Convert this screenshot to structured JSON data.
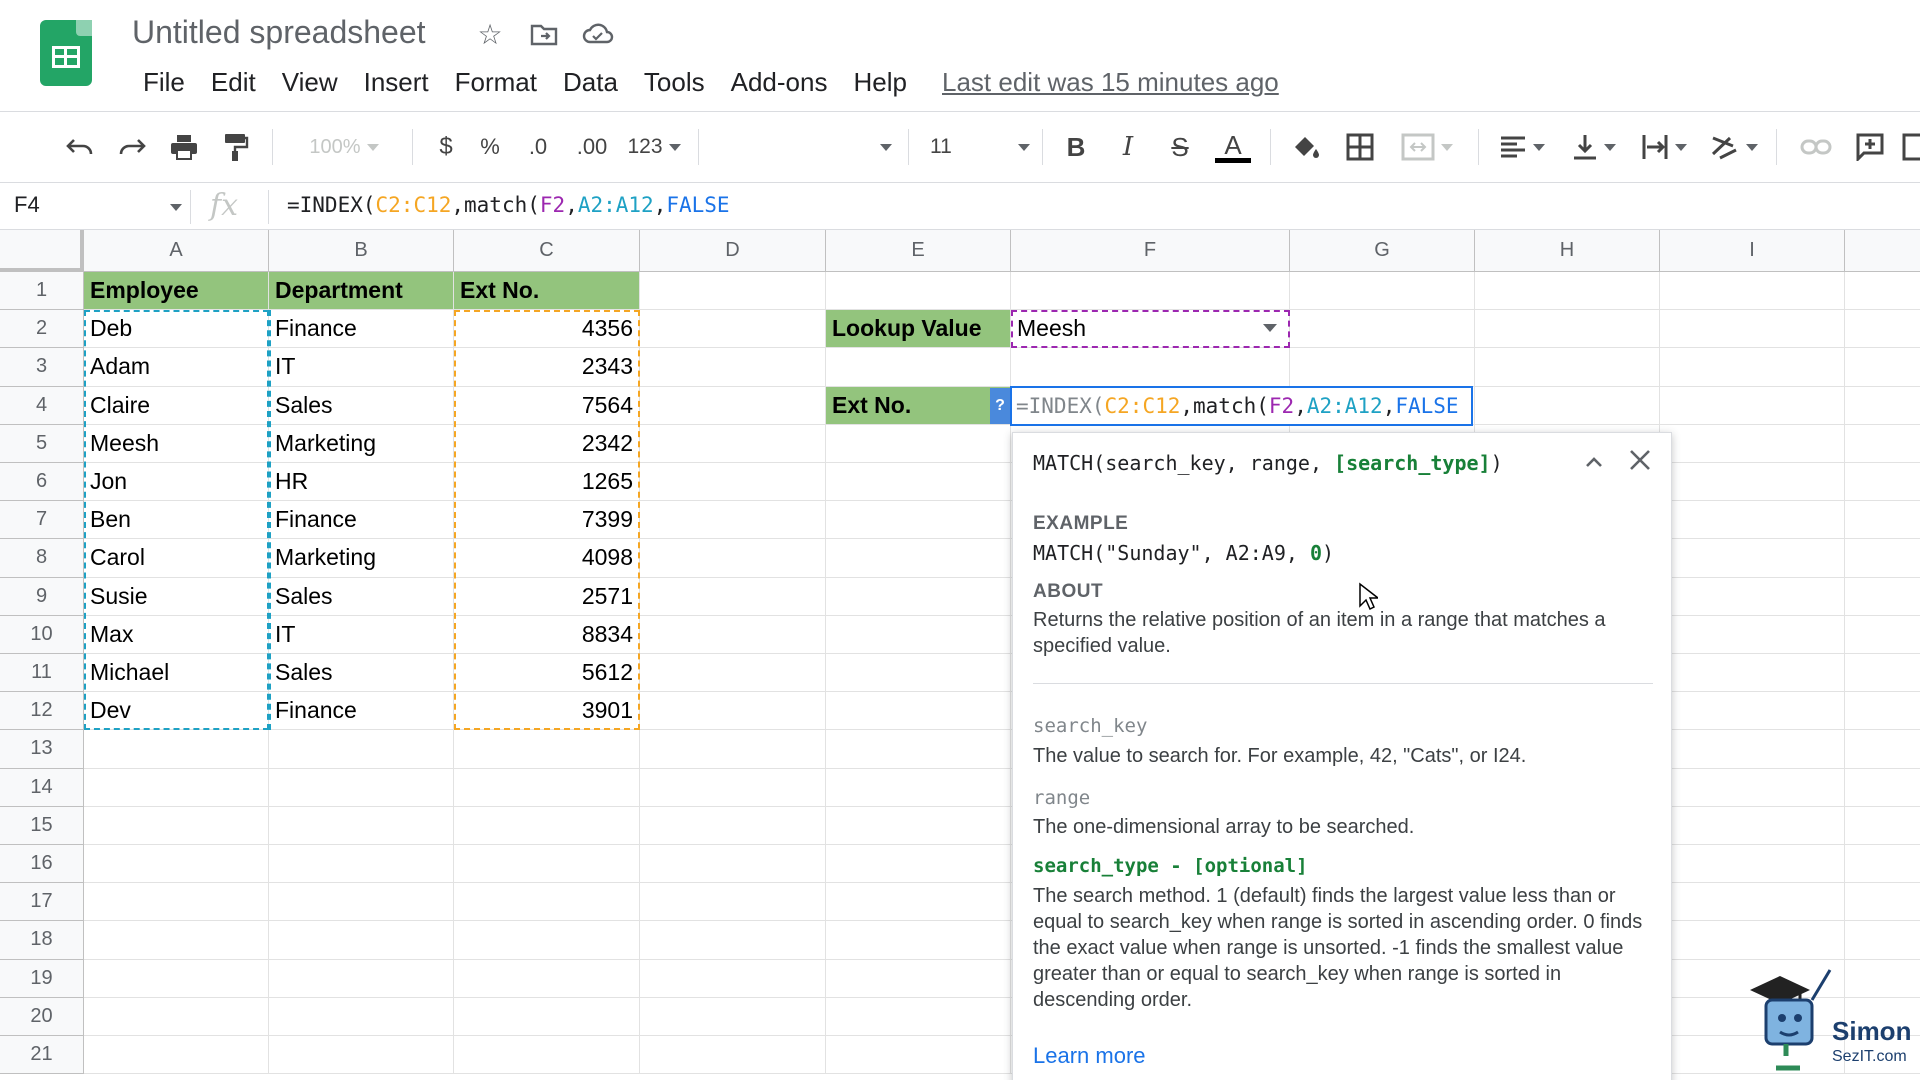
{
  "app": {
    "title": "Untitled spreadsheet",
    "menu": [
      "File",
      "Edit",
      "View",
      "Insert",
      "Format",
      "Data",
      "Tools",
      "Add-ons",
      "Help"
    ],
    "last_edit": "Last edit was 15 minutes ago"
  },
  "toolbar": {
    "zoom": "100%",
    "currency": "$",
    "percent": "%",
    "dec_decrease": ".0",
    "dec_increase": ".00",
    "more_formats": "123",
    "font_size": "11",
    "bold": "B",
    "italic": "I",
    "strike": "S",
    "text_color": "A"
  },
  "formula_bar": {
    "cell_ref": "F4",
    "fx": "fx",
    "formula_parts": [
      {
        "text": "=INDEX(",
        "color": "dark"
      },
      {
        "text": "C2:C12",
        "color": "orange"
      },
      {
        "text": ",match(",
        "color": "dark"
      },
      {
        "text": "F2",
        "color": "purple"
      },
      {
        "text": ",",
        "color": "dark"
      },
      {
        "text": "A2:A12",
        "color": "cyan"
      },
      {
        "text": ",",
        "color": "dark"
      },
      {
        "text": "FALSE",
        "color": "blue"
      }
    ]
  },
  "grid": {
    "columns": [
      "A",
      "B",
      "C",
      "D",
      "E",
      "F",
      "G",
      "H",
      "I"
    ],
    "rows": [
      "1",
      "2",
      "3",
      "4",
      "5",
      "6",
      "7",
      "8",
      "9",
      "10",
      "11",
      "12",
      "13",
      "14",
      "15",
      "16",
      "17",
      "18",
      "19",
      "20",
      "21"
    ],
    "table_headers": [
      "Employee",
      "Department",
      "Ext No."
    ],
    "table_rows": [
      [
        "Deb",
        "Finance",
        "4356"
      ],
      [
        "Adam",
        "IT",
        "2343"
      ],
      [
        "Claire",
        "Sales",
        "7564"
      ],
      [
        "Meesh",
        "Marketing",
        "2342"
      ],
      [
        "Jon",
        "HR",
        "1265"
      ],
      [
        "Ben",
        "Finance",
        "7399"
      ],
      [
        "Carol",
        "Marketing",
        "4098"
      ],
      [
        "Susie",
        "Sales",
        "2571"
      ],
      [
        "Max",
        "IT",
        "8834"
      ],
      [
        "Michael",
        "Sales",
        "5612"
      ],
      [
        "Dev",
        "Finance",
        "3901"
      ]
    ],
    "lookup_label": "Lookup Value",
    "lookup_value": "Meesh",
    "result_label": "Ext No.",
    "help_toggle": "?"
  },
  "function_help": {
    "signature_main": "MATCH(search_key, range, ",
    "signature_opt": "[search_type]",
    "signature_end": ")",
    "example_label": "EXAMPLE",
    "example_main": "MATCH(\"Sunday\", A2:A9, ",
    "example_num": "0",
    "example_end": ")",
    "about_label": "ABOUT",
    "about_text": "Returns the relative position of an item in a range that matches a specified value.",
    "params": [
      {
        "name": "search_key",
        "desc": "The value to search for. For example, 42, \"Cats\", or I24."
      },
      {
        "name": "range",
        "desc": "The one-dimensional array to be searched."
      },
      {
        "name": "search_type - [optional]",
        "desc": "The search method. 1 (default) finds the largest value less than or equal to search_key when range is sorted in ascending order. 0 finds the exact value when range is unsorted. -1 finds the smallest value greater than or equal to search_key when range is sorted in descending order."
      }
    ],
    "learn_more": "Learn more"
  },
  "watermark": {
    "line1": "Simon",
    "line2": "SezIT.com"
  },
  "colors": {
    "header_green": "#93c47d",
    "range_cyan": "#1ea1c4",
    "range_orange": "#f5a623",
    "range_purple": "#9c27b0",
    "accent_blue": "#1a73e8"
  }
}
